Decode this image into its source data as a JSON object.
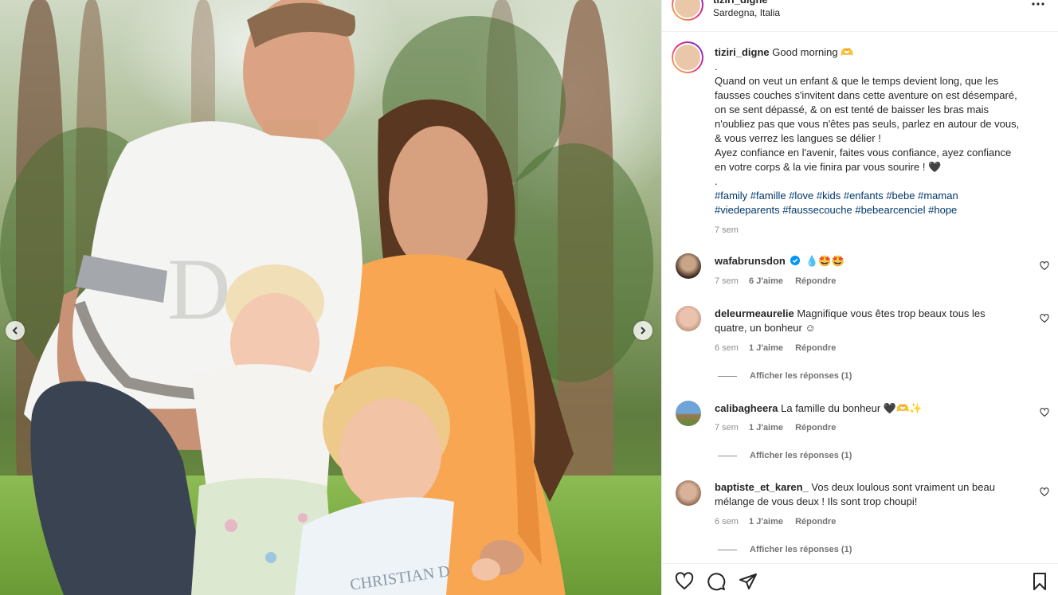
{
  "media": {
    "prev_arrow": "chevron-left-icon",
    "next_arrow": "chevron-right-icon",
    "print_text": "CHRISTIAN D"
  },
  "header": {
    "username": "tiziri_digne",
    "location": "Sardegna, Italia",
    "more_icon": "ellipsis-icon"
  },
  "caption": {
    "username": "tiziri_digne",
    "lines": [
      "Good morning 🫶",
      ".",
      "Quand on veut un enfant & que le temps devient long, que les",
      "fausses couches s'invitent dans cette aventure on est désemparé,",
      "on se sent dépassé, & on est tenté de baisser les bras mais",
      "n'oubliez pas que vous n'êtes pas seuls, parlez en autour de vous,",
      "& vous verrez les langues se délier !",
      "Ayez confiance en l'avenir, faites vous confiance, ayez confiance",
      "en votre corps & la vie finira par vous sourire ! 🖤",
      "."
    ],
    "hashtags_line1": "#family #famille #love #kids #enfants #bebe #maman",
    "hashtags_line2": "#viedeparents #faussecouche #bebearcenciel #hope",
    "time": "7 sem"
  },
  "comments": [
    {
      "username": "wafabrunsdon",
      "text": "💧🤩🤩",
      "text2": "",
      "time": "7 sem",
      "likes": "6 J'aime",
      "reply": "Répondre",
      "view_replies": ""
    },
    {
      "username": "deleurmeaurelie",
      "text": "Magnifique vous êtes trop beaux tous les",
      "text2": "quatre, un bonheur ☺",
      "time": "6 sem",
      "likes": "1 J'aime",
      "reply": "Répondre",
      "view_replies": "Afficher les réponses (1)"
    },
    {
      "username": "calibagheera",
      "text": "La famille du bonheur 🖤🫶✨",
      "text2": "",
      "time": "7 sem",
      "likes": "1 J'aime",
      "reply": "Répondre",
      "view_replies": "Afficher les réponses (1)"
    },
    {
      "username": "baptiste_et_karen_",
      "text": "Vos deux loulous sont vraiment un beau",
      "text2": "mélange de vous deux ! Ils sont trop choupi!",
      "time": "6 sem",
      "likes": "1 J'aime",
      "reply": "Répondre",
      "view_replies": "Afficher les réponses (1)"
    }
  ],
  "footer": {
    "icons": [
      "heart-icon",
      "comment-icon",
      "share-icon",
      "bookmark-icon"
    ]
  },
  "colors": {
    "text": "#262626",
    "secondary": "#8e8e8e",
    "hashtag": "#00376b",
    "verified": "#0095f6",
    "border": "#efefef"
  }
}
